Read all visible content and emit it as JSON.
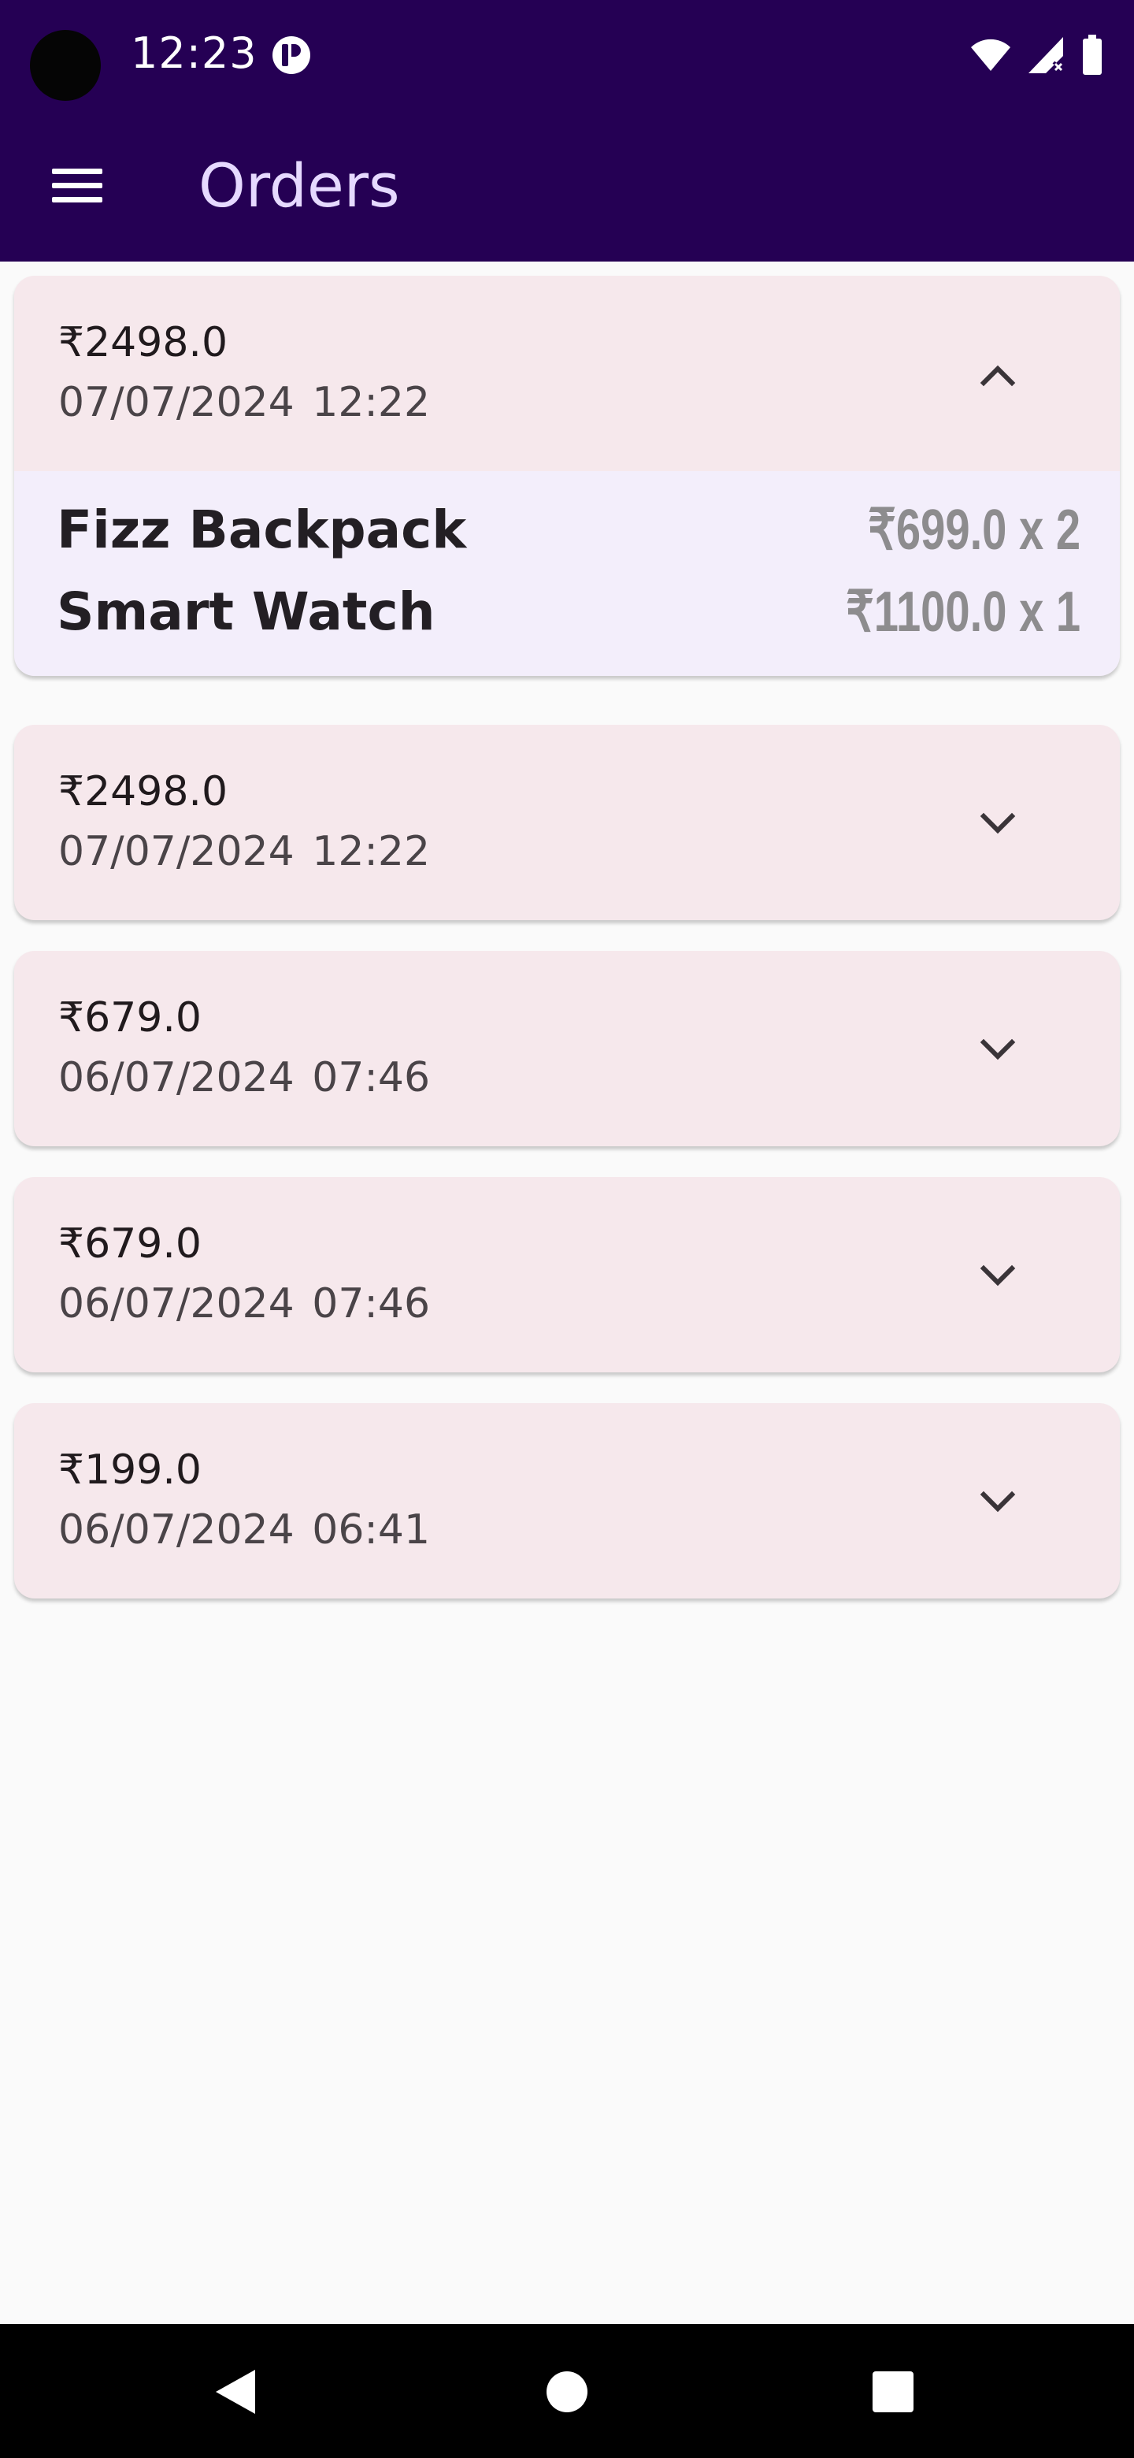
{
  "status_bar": {
    "time": "12:23",
    "icons": [
      "camera-cutout",
      "app-notification-icon",
      "wifi-icon",
      "signal-icon",
      "battery-icon"
    ]
  },
  "app_bar": {
    "title": "Orders",
    "menu_icon": "hamburger-menu-icon",
    "background": "#250054",
    "title_color": "#e6d9ff"
  },
  "orders": [
    {
      "total": "₹2498.0",
      "date": "07/07/2024 12:22",
      "expanded": true,
      "items": [
        {
          "name": "Fizz Backpack",
          "price": "₹699.0 x 2"
        },
        {
          "name": "Smart Watch",
          "price": "₹1100.0 x 1"
        }
      ]
    },
    {
      "total": "₹2498.0",
      "date": "07/07/2024 12:22",
      "expanded": false
    },
    {
      "total": "₹679.0",
      "date": "06/07/2024 07:46",
      "expanded": false
    },
    {
      "total": "₹679.0",
      "date": "06/07/2024 07:46",
      "expanded": false
    },
    {
      "total": "₹199.0",
      "date": "06/07/2024 06:41",
      "expanded": false
    }
  ],
  "colors": {
    "card_background": "#f6e8ec",
    "details_background": "#f3eefb",
    "price_color": "#8d8c8e"
  },
  "nav_bar": {
    "buttons": [
      "back-icon",
      "home-icon",
      "recents-icon"
    ]
  }
}
